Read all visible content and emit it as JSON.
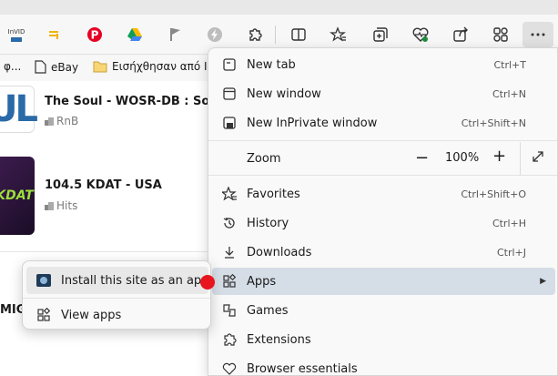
{
  "toolbar": {
    "extension_label": "InVID"
  },
  "bookmarks": [
    {
      "label": "φ...",
      "icon": "page-icon"
    },
    {
      "label": "eBay",
      "icon": "page-icon"
    },
    {
      "label": "Εισήχθησαν από Ιn",
      "icon": "folder-icon"
    }
  ],
  "stations": [
    {
      "title": "The Soul - WOSR-DB : Soul S",
      "genre": "RnB",
      "art_text": "UL"
    },
    {
      "title": "104.5 KDAT - USA",
      "genre": "Hits",
      "art_text": "KDAT"
    }
  ],
  "partial_text": "MIG",
  "menu": {
    "items": [
      {
        "label": "New tab",
        "shortcut": "Ctrl+T",
        "icon": "new-tab-icon"
      },
      {
        "label": "New window",
        "shortcut": "Ctrl+N",
        "icon": "new-window-icon"
      },
      {
        "label": "New InPrivate window",
        "shortcut": "Ctrl+Shift+N",
        "icon": "inprivate-icon"
      },
      {
        "label": "Favorites",
        "shortcut": "Ctrl+Shift+O",
        "icon": "star-icon"
      },
      {
        "label": "History",
        "shortcut": "Ctrl+H",
        "icon": "history-icon"
      },
      {
        "label": "Downloads",
        "shortcut": "Ctrl+J",
        "icon": "download-icon"
      },
      {
        "label": "Apps",
        "shortcut": "",
        "icon": "apps-icon"
      },
      {
        "label": "Games",
        "shortcut": "",
        "icon": "games-icon"
      },
      {
        "label": "Extensions",
        "shortcut": "",
        "icon": "puzzle-icon"
      },
      {
        "label": "Browser essentials",
        "shortcut": "",
        "icon": "heart-icon"
      }
    ],
    "zoom": {
      "label": "Zoom",
      "value": "100%",
      "minus": "−",
      "plus": "+"
    }
  },
  "submenu": {
    "items": [
      {
        "label": "Install this site as an app",
        "icon": "site-app-icon"
      },
      {
        "label": "View apps",
        "icon": "apps-icon"
      }
    ]
  },
  "colors": {
    "highlight": "#d5dde6",
    "cursor": "#e8141e",
    "accent": "#2a6aa8"
  }
}
